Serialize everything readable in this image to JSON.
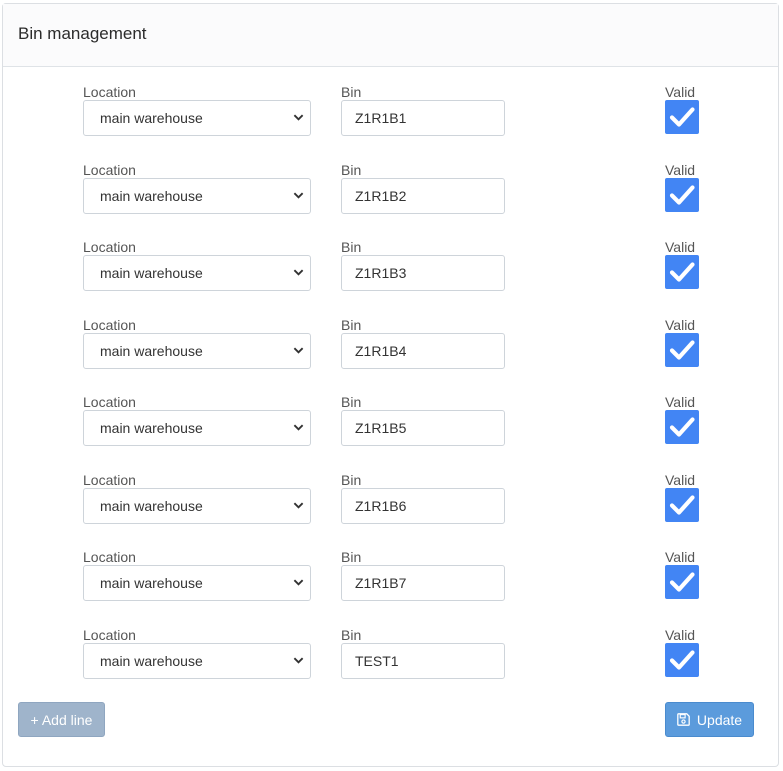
{
  "header": {
    "title": "Bin management"
  },
  "labels": {
    "location": "Location",
    "bin": "Bin",
    "valid": "Valid"
  },
  "rows": [
    {
      "location": "main warehouse",
      "bin": "Z1R1B1",
      "valid": true
    },
    {
      "location": "main warehouse",
      "bin": "Z1R1B2",
      "valid": true
    },
    {
      "location": "main warehouse",
      "bin": "Z1R1B3",
      "valid": true
    },
    {
      "location": "main warehouse",
      "bin": "Z1R1B4",
      "valid": true
    },
    {
      "location": "main warehouse",
      "bin": "Z1R1B5",
      "valid": true
    },
    {
      "location": "main warehouse",
      "bin": "Z1R1B6",
      "valid": true
    },
    {
      "location": "main warehouse",
      "bin": "Z1R1B7",
      "valid": true
    },
    {
      "location": "main warehouse",
      "bin": "TEST1",
      "valid": true
    }
  ],
  "buttons": {
    "add_line": "+ Add line",
    "update": "Update"
  },
  "icons": {
    "chevron": "chevron-down-icon",
    "check": "check-icon",
    "save": "save-icon"
  },
  "colors": {
    "checkbox": "#4285f4",
    "update_button": "#5b9bdc",
    "add_button": "#9fb4cb"
  }
}
